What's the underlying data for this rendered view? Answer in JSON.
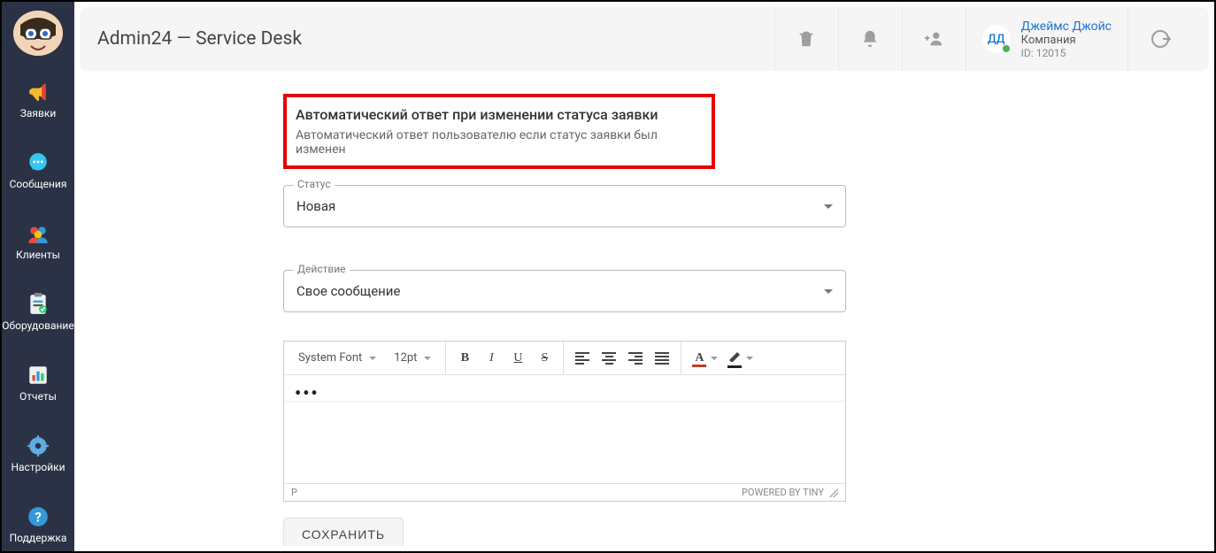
{
  "header": {
    "title": "Admin24 — Service Desk",
    "user": {
      "initials": "ДД",
      "name": "Джеймс Джойс",
      "company": "Компания",
      "id_label": "ID: 12015"
    }
  },
  "sidebar": {
    "items": [
      {
        "label": "Заявки"
      },
      {
        "label": "Сообщения"
      },
      {
        "label": "Клиенты"
      },
      {
        "label": "Оборудование"
      },
      {
        "label": "Отчеты"
      },
      {
        "label": "Настройки"
      },
      {
        "label": "Поддержка"
      }
    ]
  },
  "section": {
    "title": "Автоматический ответ при изменении статуса заявки",
    "subtitle": "Автоматический ответ пользователю если статус заявки был изменен",
    "status_label": "Статус",
    "status_value": "Новая",
    "action_label": "Действие",
    "action_value": "Свое сообщение",
    "save_label": "СОХРАНИТЬ"
  },
  "editor": {
    "font_family": "System Font",
    "font_size": "12pt",
    "body": "•••",
    "status_path": "P",
    "powered": "POWERED BY TINY"
  }
}
